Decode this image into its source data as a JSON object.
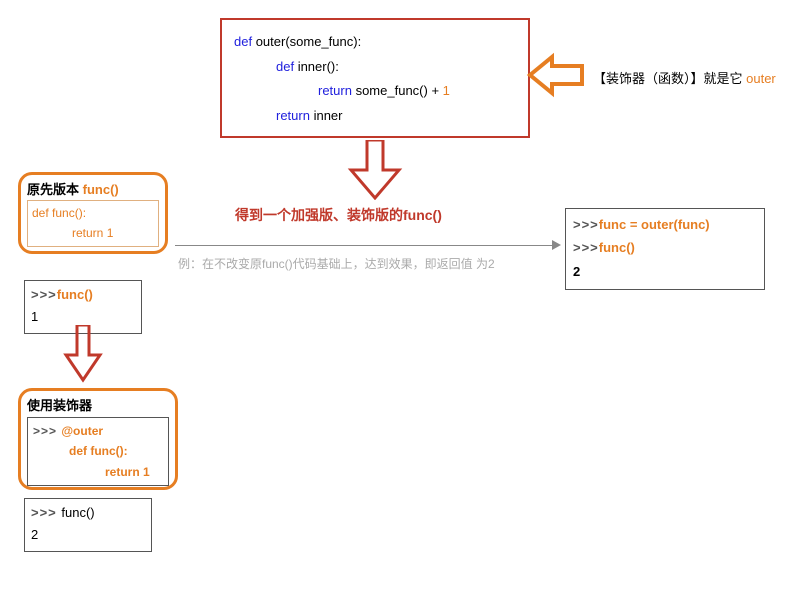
{
  "topCode": {
    "l1a": "def ",
    "l1b": "outer(some_func):",
    "l2a": "def ",
    "l2b": "inner():",
    "l3a": "return ",
    "l3b": "some_func() + ",
    "l3c": "1",
    "l4a": "return ",
    "l4b": "inner"
  },
  "annotRight": {
    "t1": "【装饰器（函数）】就是它 ",
    "t2": "outer"
  },
  "middle": "得到一个加强版、装饰版的func()",
  "gray": "例：在不改变原func()代码基础上，达到效果，即返回值 为2",
  "left1": {
    "title1": "原先版本 ",
    "title2": "func()",
    "c1a": "def ",
    "c1b": "func():",
    "c2a": "return ",
    "c2b": "1"
  },
  "call1": {
    "prompt": ">>>",
    "fn": "func()",
    "result": "1"
  },
  "left2": {
    "title": "使用装饰器",
    "prompt": ">>> ",
    "c1": "@outer",
    "c2a": "def ",
    "c2b": "func():",
    "c3a": "return ",
    "c3b": "1"
  },
  "call2": {
    "prompt": ">>> ",
    "fn": "func()",
    "result": "2"
  },
  "right": {
    "prompt": ">>>",
    "l1": "func = outer(func)",
    "l2": "func()",
    "result": "2"
  }
}
